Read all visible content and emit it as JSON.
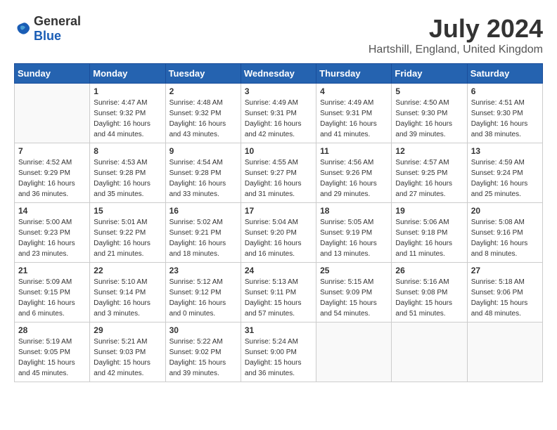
{
  "logo": {
    "general": "General",
    "blue": "Blue"
  },
  "title": "July 2024",
  "location": "Hartshill, England, United Kingdom",
  "headers": [
    "Sunday",
    "Monday",
    "Tuesday",
    "Wednesday",
    "Thursday",
    "Friday",
    "Saturday"
  ],
  "weeks": [
    [
      {
        "day": "",
        "info": ""
      },
      {
        "day": "1",
        "info": "Sunrise: 4:47 AM\nSunset: 9:32 PM\nDaylight: 16 hours\nand 44 minutes."
      },
      {
        "day": "2",
        "info": "Sunrise: 4:48 AM\nSunset: 9:32 PM\nDaylight: 16 hours\nand 43 minutes."
      },
      {
        "day": "3",
        "info": "Sunrise: 4:49 AM\nSunset: 9:31 PM\nDaylight: 16 hours\nand 42 minutes."
      },
      {
        "day": "4",
        "info": "Sunrise: 4:49 AM\nSunset: 9:31 PM\nDaylight: 16 hours\nand 41 minutes."
      },
      {
        "day": "5",
        "info": "Sunrise: 4:50 AM\nSunset: 9:30 PM\nDaylight: 16 hours\nand 39 minutes."
      },
      {
        "day": "6",
        "info": "Sunrise: 4:51 AM\nSunset: 9:30 PM\nDaylight: 16 hours\nand 38 minutes."
      }
    ],
    [
      {
        "day": "7",
        "info": "Sunrise: 4:52 AM\nSunset: 9:29 PM\nDaylight: 16 hours\nand 36 minutes."
      },
      {
        "day": "8",
        "info": "Sunrise: 4:53 AM\nSunset: 9:28 PM\nDaylight: 16 hours\nand 35 minutes."
      },
      {
        "day": "9",
        "info": "Sunrise: 4:54 AM\nSunset: 9:28 PM\nDaylight: 16 hours\nand 33 minutes."
      },
      {
        "day": "10",
        "info": "Sunrise: 4:55 AM\nSunset: 9:27 PM\nDaylight: 16 hours\nand 31 minutes."
      },
      {
        "day": "11",
        "info": "Sunrise: 4:56 AM\nSunset: 9:26 PM\nDaylight: 16 hours\nand 29 minutes."
      },
      {
        "day": "12",
        "info": "Sunrise: 4:57 AM\nSunset: 9:25 PM\nDaylight: 16 hours\nand 27 minutes."
      },
      {
        "day": "13",
        "info": "Sunrise: 4:59 AM\nSunset: 9:24 PM\nDaylight: 16 hours\nand 25 minutes."
      }
    ],
    [
      {
        "day": "14",
        "info": "Sunrise: 5:00 AM\nSunset: 9:23 PM\nDaylight: 16 hours\nand 23 minutes."
      },
      {
        "day": "15",
        "info": "Sunrise: 5:01 AM\nSunset: 9:22 PM\nDaylight: 16 hours\nand 21 minutes."
      },
      {
        "day": "16",
        "info": "Sunrise: 5:02 AM\nSunset: 9:21 PM\nDaylight: 16 hours\nand 18 minutes."
      },
      {
        "day": "17",
        "info": "Sunrise: 5:04 AM\nSunset: 9:20 PM\nDaylight: 16 hours\nand 16 minutes."
      },
      {
        "day": "18",
        "info": "Sunrise: 5:05 AM\nSunset: 9:19 PM\nDaylight: 16 hours\nand 13 minutes."
      },
      {
        "day": "19",
        "info": "Sunrise: 5:06 AM\nSunset: 9:18 PM\nDaylight: 16 hours\nand 11 minutes."
      },
      {
        "day": "20",
        "info": "Sunrise: 5:08 AM\nSunset: 9:16 PM\nDaylight: 16 hours\nand 8 minutes."
      }
    ],
    [
      {
        "day": "21",
        "info": "Sunrise: 5:09 AM\nSunset: 9:15 PM\nDaylight: 16 hours\nand 6 minutes."
      },
      {
        "day": "22",
        "info": "Sunrise: 5:10 AM\nSunset: 9:14 PM\nDaylight: 16 hours\nand 3 minutes."
      },
      {
        "day": "23",
        "info": "Sunrise: 5:12 AM\nSunset: 9:12 PM\nDaylight: 16 hours\nand 0 minutes."
      },
      {
        "day": "24",
        "info": "Sunrise: 5:13 AM\nSunset: 9:11 PM\nDaylight: 15 hours\nand 57 minutes."
      },
      {
        "day": "25",
        "info": "Sunrise: 5:15 AM\nSunset: 9:09 PM\nDaylight: 15 hours\nand 54 minutes."
      },
      {
        "day": "26",
        "info": "Sunrise: 5:16 AM\nSunset: 9:08 PM\nDaylight: 15 hours\nand 51 minutes."
      },
      {
        "day": "27",
        "info": "Sunrise: 5:18 AM\nSunset: 9:06 PM\nDaylight: 15 hours\nand 48 minutes."
      }
    ],
    [
      {
        "day": "28",
        "info": "Sunrise: 5:19 AM\nSunset: 9:05 PM\nDaylight: 15 hours\nand 45 minutes."
      },
      {
        "day": "29",
        "info": "Sunrise: 5:21 AM\nSunset: 9:03 PM\nDaylight: 15 hours\nand 42 minutes."
      },
      {
        "day": "30",
        "info": "Sunrise: 5:22 AM\nSunset: 9:02 PM\nDaylight: 15 hours\nand 39 minutes."
      },
      {
        "day": "31",
        "info": "Sunrise: 5:24 AM\nSunset: 9:00 PM\nDaylight: 15 hours\nand 36 minutes."
      },
      {
        "day": "",
        "info": ""
      },
      {
        "day": "",
        "info": ""
      },
      {
        "day": "",
        "info": ""
      }
    ]
  ]
}
